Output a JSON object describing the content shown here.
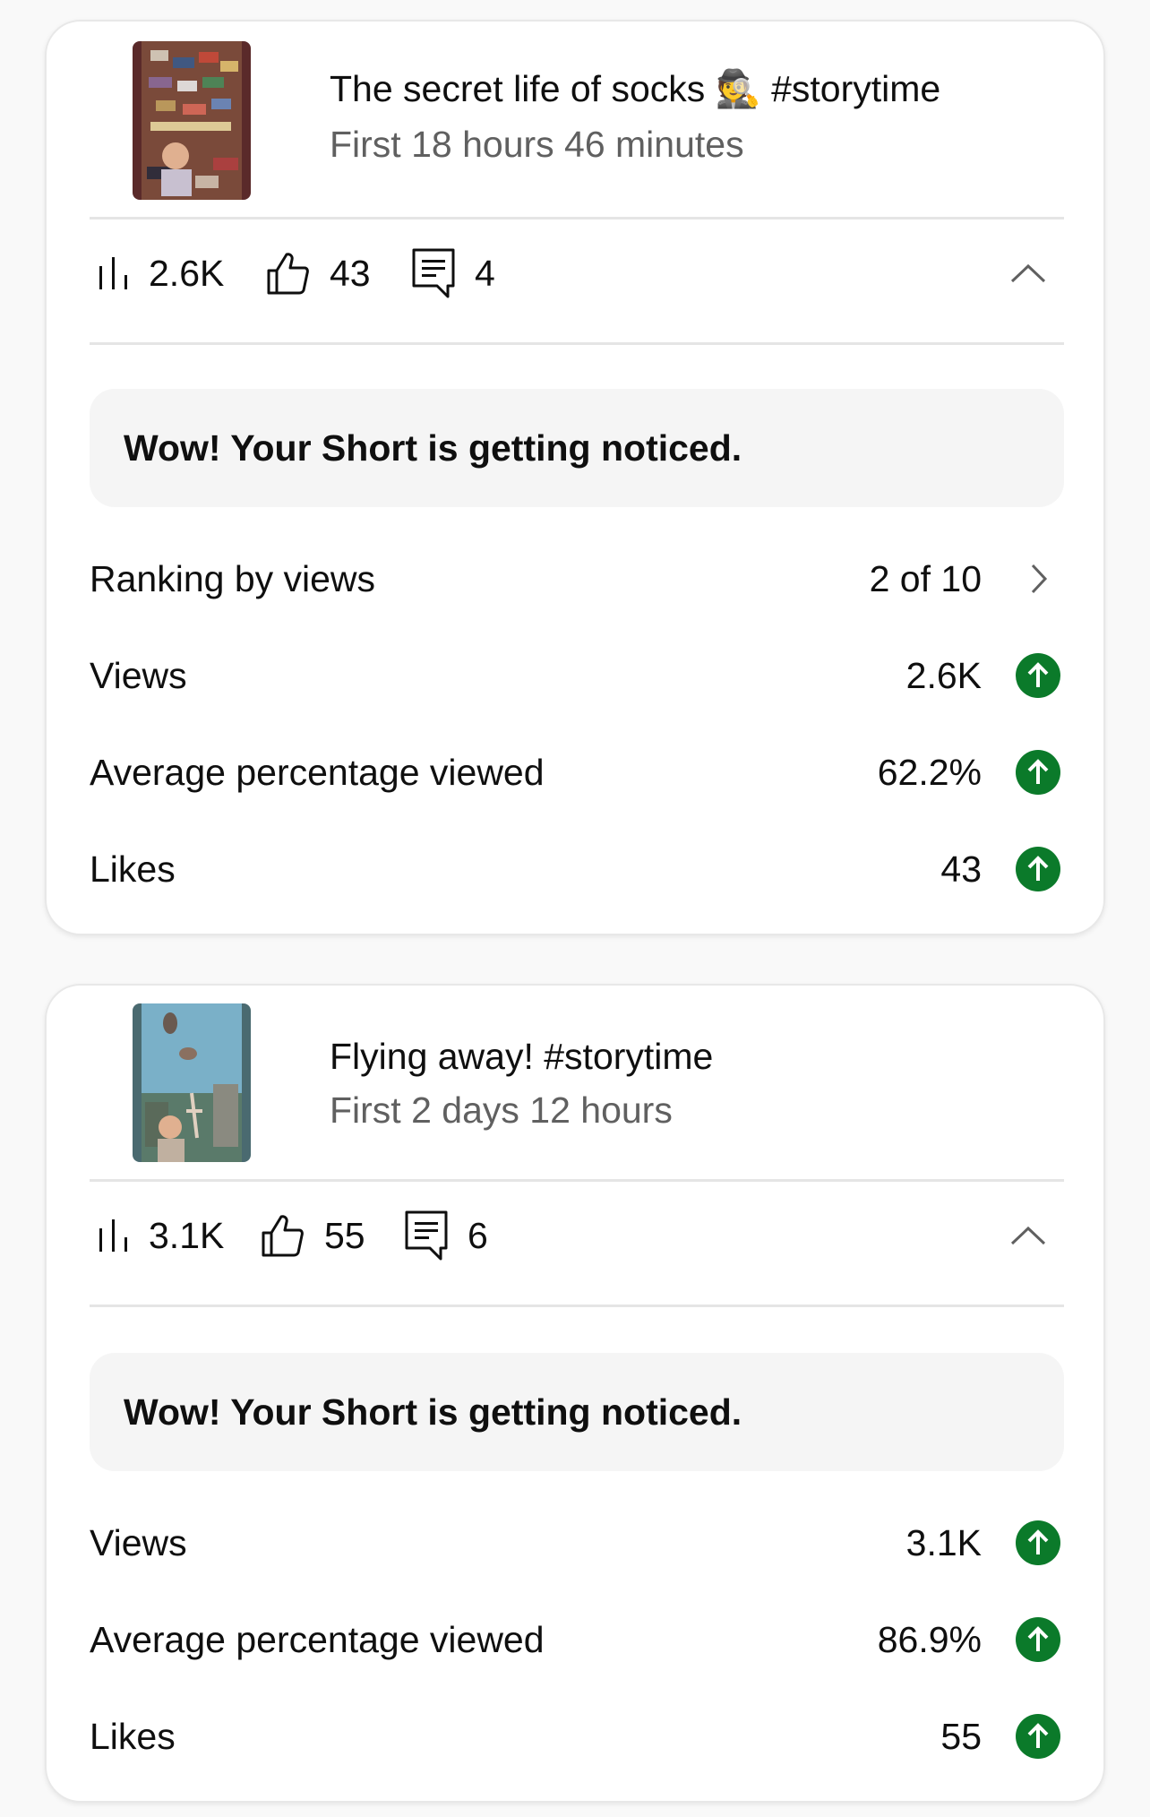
{
  "colors": {
    "accent_green": "#0b7a2a",
    "secondary_text": "#606060",
    "banner_bg": "#f5f5f5"
  },
  "cards": [
    {
      "title": "The secret life of socks 🕵️ #storytime",
      "subtitle": "First 18 hours 46 minutes",
      "stats": {
        "views": "2.6K",
        "likes": "43",
        "comments": "4"
      },
      "banner": "Wow! Your Short is getting noticed.",
      "ranking": {
        "label": "Ranking by views",
        "value": "2 of 10"
      },
      "metrics": [
        {
          "label": "Views",
          "value": "2.6K",
          "trend_icon": "arrow-up-circle-icon"
        },
        {
          "label": "Average percentage viewed",
          "value": "62.2%",
          "trend_icon": "arrow-up-circle-icon"
        },
        {
          "label": "Likes",
          "value": "43",
          "trend_icon": "arrow-up-circle-icon"
        }
      ]
    },
    {
      "title": "Flying away! #storytime",
      "subtitle": "First 2 days 12 hours",
      "stats": {
        "views": "3.1K",
        "likes": "55",
        "comments": "6"
      },
      "banner": "Wow! Your Short is getting noticed.",
      "metrics": [
        {
          "label": "Views",
          "value": "3.1K",
          "trend_icon": "arrow-up-circle-icon"
        },
        {
          "label": "Average percentage viewed",
          "value": "86.9%",
          "trend_icon": "arrow-up-circle-icon"
        },
        {
          "label": "Likes",
          "value": "55",
          "trend_icon": "arrow-up-circle-icon"
        }
      ]
    }
  ]
}
